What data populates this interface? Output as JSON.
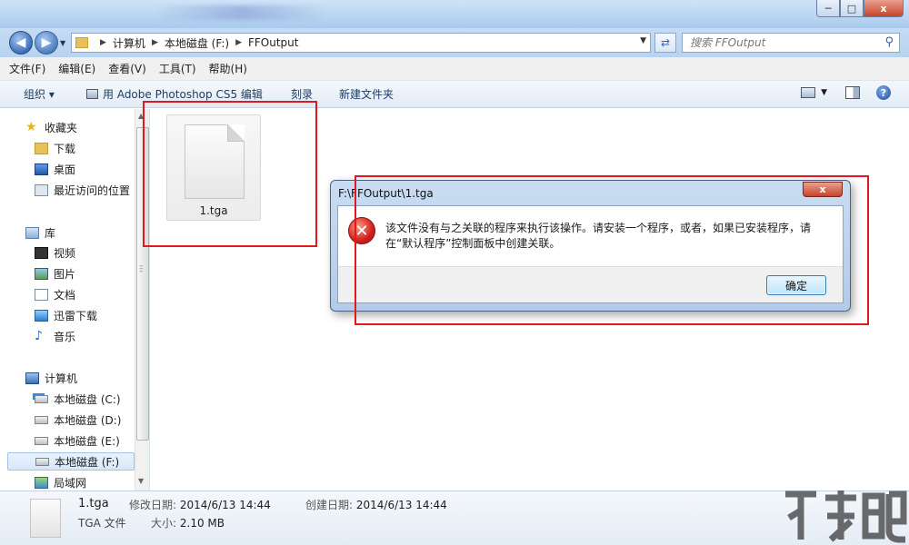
{
  "window": {
    "minimize": "─",
    "maximize": "□",
    "close": "x"
  },
  "address": {
    "crumbs": [
      "计算机",
      "本地磁盘 (F:)",
      "FFOutput"
    ]
  },
  "search": {
    "placeholder": "搜索 FFOutput"
  },
  "menu": [
    "文件(F)",
    "编辑(E)",
    "查看(V)",
    "工具(T)",
    "帮助(H)"
  ],
  "toolbar": {
    "organize": "组织 ▾",
    "edit_with": "用 Adobe Photoshop CS5 编辑",
    "burn": "刻录",
    "new_folder": "新建文件夹"
  },
  "nav": {
    "favorites": "收藏夹",
    "downloads": "下载",
    "desktop": "桌面",
    "recent": "最近访问的位置",
    "libraries": "库",
    "videos": "视频",
    "pictures": "图片",
    "documents": "文档",
    "xunlei": "迅雷下载",
    "music": "音乐",
    "computer": "计算机",
    "drive_c": "本地磁盘 (C:)",
    "drive_d": "本地磁盘 (D:)",
    "drive_e": "本地磁盘 (E:)",
    "drive_f": "本地磁盘 (F:)",
    "network": "局域网"
  },
  "files": [
    {
      "name": "1.tga"
    }
  ],
  "dialog": {
    "title": "F:\\FFOutput\\1.tga",
    "close": "x",
    "message": "该文件没有与之关联的程序来执行该操作。请安装一个程序，或者，如果已安装程序，请在“默认程序”控制面板中创建关联。",
    "ok": "确定"
  },
  "details": {
    "name": "1.tga",
    "type": "TGA 文件",
    "modified_label": "修改日期:",
    "modified": "2014/6/13 14:44",
    "size_label": "大小:",
    "size": "2.10 MB",
    "created_label": "创建日期:",
    "created": "2014/6/13 14:44"
  },
  "colors": {
    "highlight_box": "#e0191e",
    "error_icon": "#d1201b"
  }
}
